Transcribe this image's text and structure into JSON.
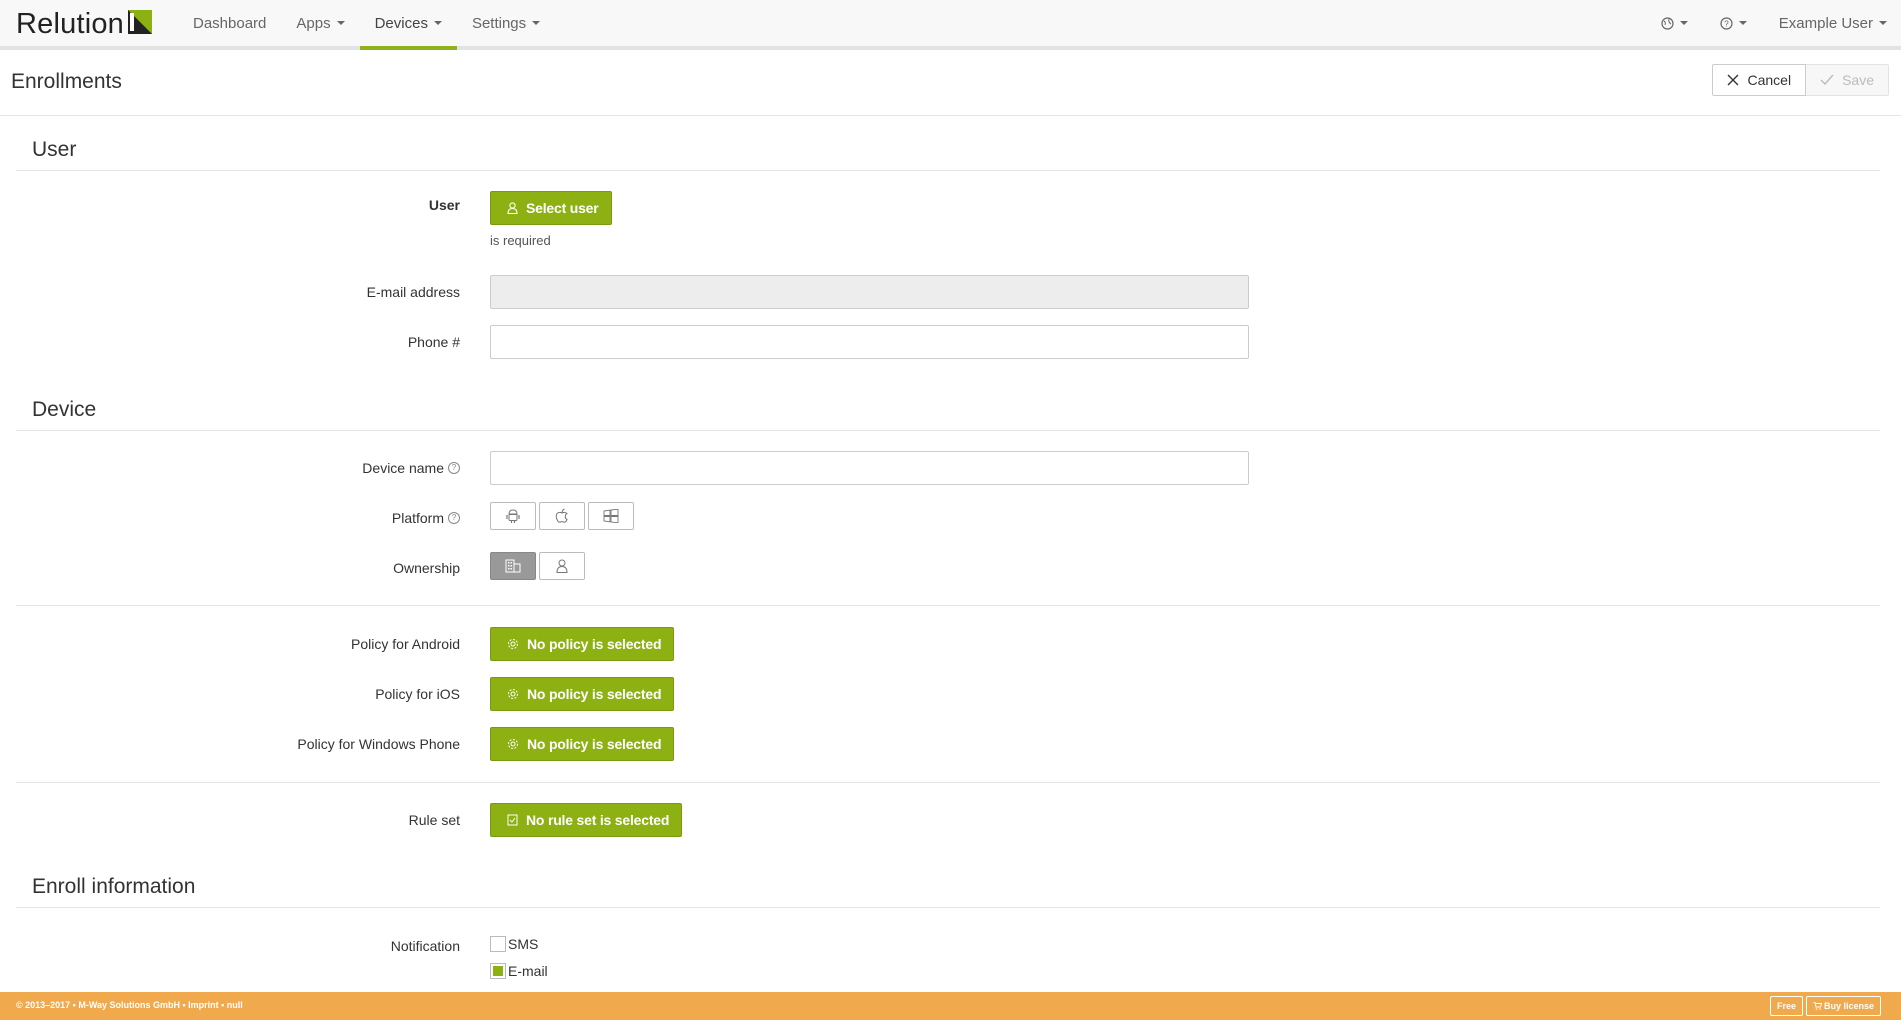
{
  "brand": {
    "name": "Relution",
    "accent": "#8db012",
    "footer_color": "#f0a94c"
  },
  "nav": {
    "items": [
      {
        "label": "Dashboard",
        "has_caret": false
      },
      {
        "label": "Apps",
        "has_caret": true
      },
      {
        "label": "Devices",
        "has_caret": true,
        "active": true
      },
      {
        "label": "Settings",
        "has_caret": true
      }
    ],
    "right": {
      "globe_icon": "globe-icon",
      "help_icon": "help-icon",
      "user_label": "Example User"
    }
  },
  "page": {
    "title": "Enrollments",
    "cancel_label": "Cancel",
    "save_label": "Save"
  },
  "sections": {
    "user": {
      "title": "User",
      "user_label": "User",
      "select_user_label": "Select user",
      "required_hint": "is required",
      "email_label": "E-mail address",
      "email_value": "",
      "phone_label": "Phone #",
      "phone_value": ""
    },
    "device": {
      "title": "Device",
      "device_name_label": "Device name",
      "device_name_value": "",
      "platform_label": "Platform",
      "platform_options": [
        "android-icon",
        "apple-icon",
        "windows-icon"
      ],
      "ownership_label": "Ownership",
      "ownership_options": [
        "company-icon",
        "personal-icon"
      ],
      "ownership_selected": "company-icon",
      "policy_android_label": "Policy for Android",
      "policy_ios_label": "Policy for iOS",
      "policy_windows_label": "Policy for Windows Phone",
      "no_policy_label": "No policy is selected",
      "rule_set_label": "Rule set",
      "no_rule_set_label": "No rule set is selected"
    },
    "enroll": {
      "title": "Enroll information",
      "notification_label": "Notification",
      "sms_label": "SMS",
      "sms_checked": false,
      "email_label": "E-mail",
      "email_checked": true
    }
  },
  "footer": {
    "text": "© 2013–2017 • M-Way Solutions GmbH • Imprint • null",
    "free_label": "Free",
    "buy_label": "Buy license"
  }
}
